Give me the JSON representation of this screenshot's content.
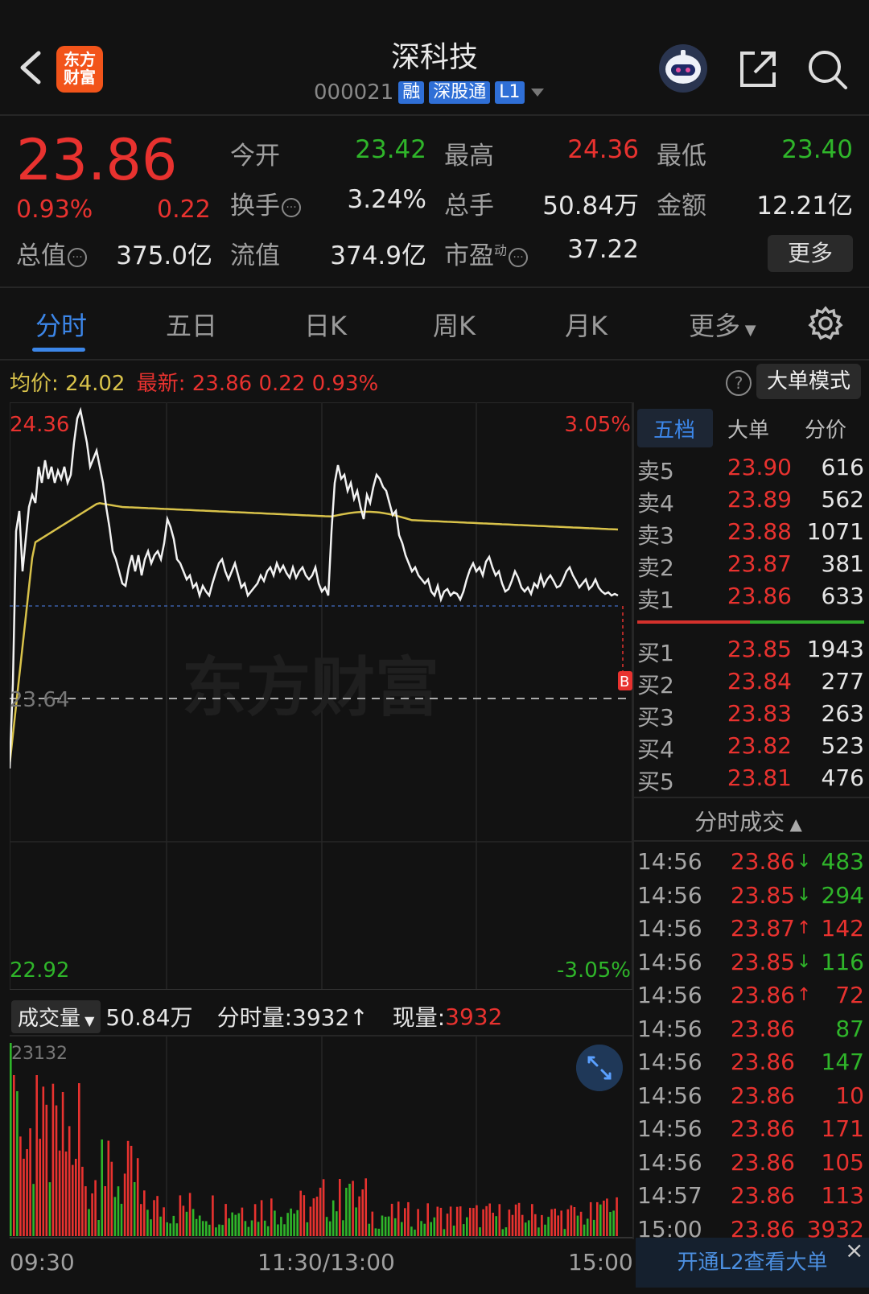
{
  "header": {
    "title": "深科技",
    "code": "000021",
    "tags": [
      "融",
      "深股通",
      "L1"
    ],
    "logo_text_1": "东方",
    "logo_text_2": "财富"
  },
  "quote": {
    "price": "23.86",
    "change_pct": "0.93%",
    "change": "0.22",
    "labels": {
      "open": "今开",
      "high": "最高",
      "low": "最低",
      "turnover": "换手",
      "volume": "总手",
      "amount": "金额",
      "mcap": "总值",
      "float": "流值",
      "pe": "市盈",
      "pe_sup": "动"
    },
    "values": {
      "open": "23.42",
      "high": "24.36",
      "low": "23.40",
      "turnover": "3.24%",
      "volume": "50.84万",
      "amount": "12.21亿",
      "mcap": "375.0亿",
      "float": "374.9亿",
      "pe": "37.22"
    },
    "more_label": "更多"
  },
  "tabs": [
    "分时",
    "五日",
    "日K",
    "周K",
    "月K",
    "更多"
  ],
  "avg_row": {
    "avg_label": "均价:",
    "avg_value": "24.02",
    "latest_label": "最新:",
    "latest_value": "23.86",
    "latest_change": "0.22",
    "latest_pct": "0.93%",
    "big_order_btn": "大单模式",
    "help": "?"
  },
  "chart_labels": {
    "top_price": "24.36",
    "top_pct": "3.05%",
    "mid_price": "23.64",
    "bottom_price": "22.92",
    "bottom_pct": "-3.05%",
    "watermark": "东方财富",
    "marker": "B"
  },
  "orderbook": {
    "tabs": [
      "五档",
      "大单",
      "分价"
    ],
    "asks": [
      {
        "label": "卖5",
        "price": "23.90",
        "vol": "616"
      },
      {
        "label": "卖4",
        "price": "23.89",
        "vol": "562"
      },
      {
        "label": "卖3",
        "price": "23.88",
        "vol": "1071"
      },
      {
        "label": "卖2",
        "price": "23.87",
        "vol": "381"
      },
      {
        "label": "卖1",
        "price": "23.86",
        "vol": "633"
      }
    ],
    "bids": [
      {
        "label": "买1",
        "price": "23.85",
        "vol": "1943"
      },
      {
        "label": "买2",
        "price": "23.84",
        "vol": "277"
      },
      {
        "label": "买3",
        "price": "23.83",
        "vol": "263"
      },
      {
        "label": "买4",
        "price": "23.82",
        "vol": "523"
      },
      {
        "label": "买5",
        "price": "23.81",
        "vol": "476"
      }
    ]
  },
  "ticks": {
    "title": "分时成交",
    "rows": [
      {
        "time": "14:56",
        "price": "23.86",
        "dir": "down",
        "vol": "483"
      },
      {
        "time": "14:56",
        "price": "23.85",
        "dir": "down",
        "vol": "294"
      },
      {
        "time": "14:56",
        "price": "23.87",
        "dir": "up",
        "vol": "142"
      },
      {
        "time": "14:56",
        "price": "23.85",
        "dir": "down",
        "vol": "116"
      },
      {
        "time": "14:56",
        "price": "23.86",
        "dir": "up",
        "vol": "72"
      },
      {
        "time": "14:56",
        "price": "23.86",
        "dir": "green",
        "vol": "87"
      },
      {
        "time": "14:56",
        "price": "23.86",
        "dir": "green",
        "vol": "147"
      },
      {
        "time": "14:56",
        "price": "23.86",
        "dir": "red",
        "vol": "10"
      },
      {
        "time": "14:56",
        "price": "23.86",
        "dir": "red",
        "vol": "171"
      },
      {
        "time": "14:56",
        "price": "23.86",
        "dir": "red",
        "vol": "105"
      },
      {
        "time": "14:57",
        "price": "23.86",
        "dir": "red",
        "vol": "113"
      },
      {
        "time": "15:00",
        "price": "23.86",
        "dir": "red",
        "vol": "3932"
      }
    ],
    "l2_banner": "开通L2查看大单",
    "close": "×"
  },
  "volume": {
    "select_label": "成交量",
    "total": "50.84万",
    "period_label": "分时量:3932↑",
    "current_label": "现量:",
    "current_value": "3932",
    "max_label": "23132"
  },
  "time_axis": [
    "09:30",
    "11:30/13:00",
    "15:00"
  ],
  "colors": {
    "up": "#e8322f",
    "down": "#2fb52a",
    "avg_line": "#d8c24a",
    "accent": "#3c86e8"
  }
}
